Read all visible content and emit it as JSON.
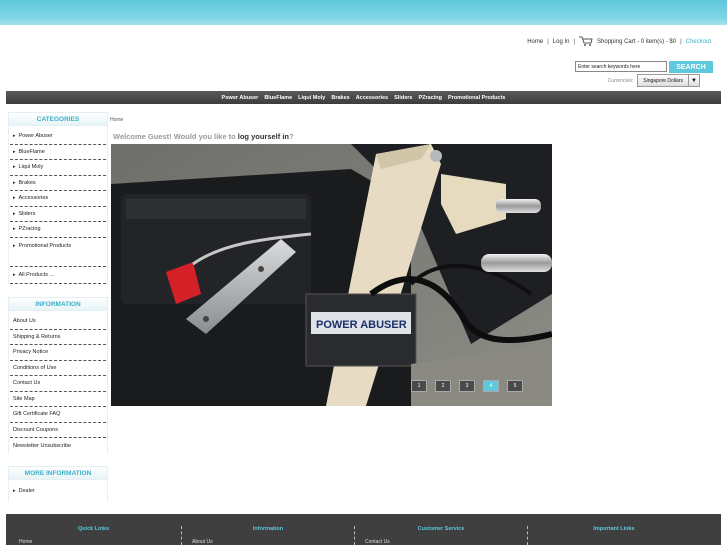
{
  "header": {
    "links": [
      {
        "label": "Home"
      },
      {
        "label": "Log In"
      }
    ],
    "cart_label": "Shopping Cart - 0 item(s) - $0",
    "checkout_label": "Checkout"
  },
  "search": {
    "value": "Enter search keywords here",
    "button_label": "SEARCH"
  },
  "currency": {
    "label": "Currencies:",
    "selected": "Singapore Dollars"
  },
  "nav": {
    "items": [
      "Power Abuser",
      "BlueFlame",
      "Liqui Moly",
      "Brakes",
      "Accessories",
      "Sliders",
      "PZracing",
      "Promotional Products"
    ]
  },
  "categories": {
    "title": "CATEGORIES",
    "items": [
      "Power Abuser",
      "BlueFlame",
      "Liqui Moly",
      "Brakes",
      "Accessories",
      "Sliders",
      "PZracing",
      "Promotional Products",
      "All Products ..."
    ]
  },
  "information": {
    "title": "INFORMATION",
    "items": [
      "About Us",
      "Shipping & Returns",
      "Privacy Notice",
      "Conditions of Use",
      "Contact Us",
      "Site Map",
      "Gift Certificate FAQ",
      "Discount Coupons",
      "Newsletter Unsubscribe"
    ]
  },
  "more_information": {
    "title": "MORE INFORMATION",
    "items": [
      "Dealer"
    ]
  },
  "main": {
    "breadcrumb": "Home",
    "welcome_prefix": "Welcome Guest! Would you like to ",
    "welcome_link": "log yourself in",
    "welcome_suffix": "?",
    "slides": [
      "1",
      "2",
      "3",
      "4",
      "5"
    ],
    "active_slide": 4,
    "hero_brand": "POWER ABUSER"
  },
  "footer": {
    "columns": [
      {
        "title": "Quick Links",
        "first": "Home"
      },
      {
        "title": "Information",
        "first": "About Us"
      },
      {
        "title": "Customer Service",
        "first": "Contact Us"
      },
      {
        "title": "Important Links",
        "first": ""
      }
    ]
  },
  "colors": {
    "accent": "#5ec8dc",
    "navbar": "#444444",
    "footer": "#3f3f3f"
  }
}
